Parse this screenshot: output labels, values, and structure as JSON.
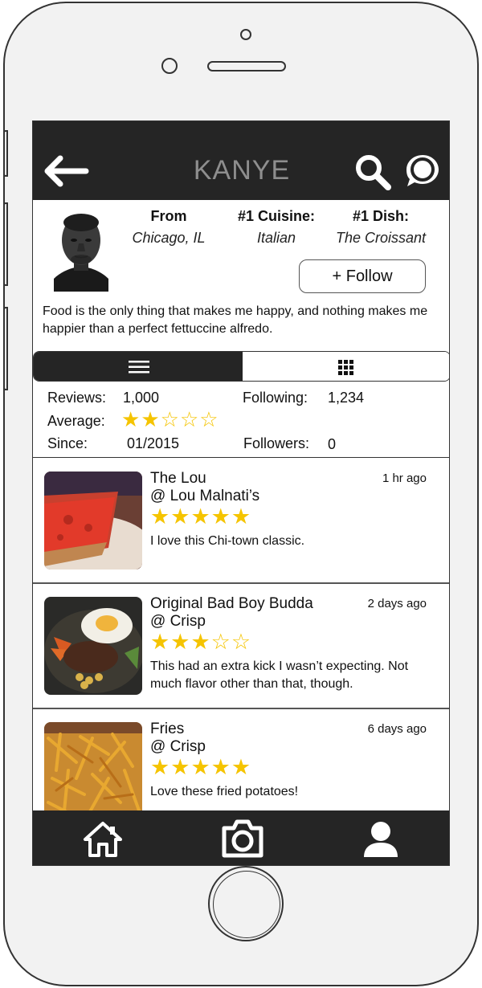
{
  "header": {
    "title": "KANYE",
    "back_icon": "arrow-left-icon",
    "search_icon": "search-icon",
    "chat_icon": "chat-bubble-icon"
  },
  "profile": {
    "from_label": "From",
    "from_value": "Chicago, IL",
    "cuisine_label": "#1 Cuisine:",
    "cuisine_value": "Italian",
    "dish_label": "#1 Dish:",
    "dish_value": "The Croissant",
    "follow_label": "+ Follow",
    "bio": "Food is the only thing that makes me happy, and nothing makes me happier than a perfect fettuccine alfredo."
  },
  "tabs": {
    "list_icon": "list-icon",
    "grid_icon": "grid-icon",
    "selected": "list"
  },
  "stats": {
    "reviews_label": "Reviews:",
    "reviews_value": "1,000",
    "average_label": "Average:",
    "average_rating": 2,
    "rating_max": 5,
    "since_label": "Since:",
    "since_value": "01/2015",
    "following_label": "Following:",
    "following_value": "1,234",
    "followers_label": "Followers:",
    "followers_value": "0"
  },
  "posts": [
    {
      "dish": "The Lou",
      "place": "@ Lou Malnati’s",
      "time": "1 hr ago",
      "rating": 5,
      "text": "I love this Chi-town classic."
    },
    {
      "dish": "Original Bad Boy Budda",
      "place": "@ Crisp",
      "time": "2 days ago",
      "rating": 3,
      "text": "This had an extra kick I wasn’t expecting. Not much flavor other than that, though."
    },
    {
      "dish": "Fries",
      "place": "@ Crisp",
      "time": "6 days ago",
      "rating": 5,
      "text": "Love these fried potatoes!"
    }
  ],
  "bottom_nav": {
    "home_icon": "home-icon",
    "camera_icon": "camera-icon",
    "profile_icon": "user-icon"
  },
  "colors": {
    "bar": "#252525",
    "star": "#f5c400",
    "title_gray": "#8e8e8e"
  }
}
